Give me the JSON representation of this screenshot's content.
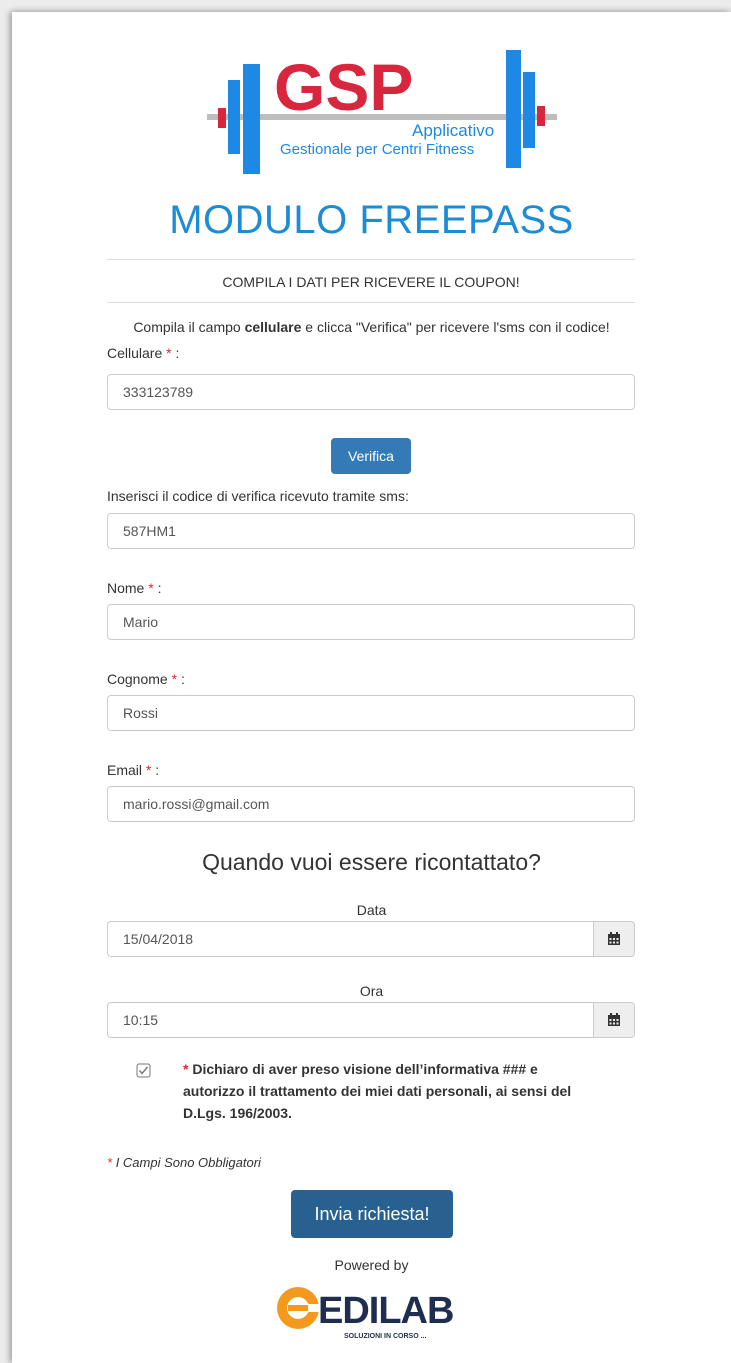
{
  "logo": {
    "text_main": "GSP",
    "text_applicativo": "Applicativo",
    "text_tagline": "Gestionale per Centri Fitness"
  },
  "page_title": "MODULO FREEPASS",
  "subheading": "COMPILA I DATI PER RICEVERE IL COUPON!",
  "instructions": {
    "prefix": "Compila il campo ",
    "bold": "cellulare",
    "suffix": " e clicca \"Verifica\" per ricevere l'sms con il codice!"
  },
  "form": {
    "required_mark": "*",
    "label_colon": ":",
    "cellulare": {
      "label": "Cellulare",
      "value": "333123789"
    },
    "verify_button": "Verifica",
    "codice": {
      "label": "Inserisci il codice di verifica ricevuto tramite sms:",
      "value": "587HM1"
    },
    "nome": {
      "label": "Nome",
      "value": "Mario"
    },
    "cognome": {
      "label": "Cognome",
      "value": "Rossi"
    },
    "email": {
      "label": "Email",
      "value": "mario.rossi@gmail.com"
    },
    "contact_question": "Quando vuoi essere ricontattato?",
    "data": {
      "label": "Data",
      "value": "15/04/2018"
    },
    "ora": {
      "label": "Ora",
      "value": "10:15"
    },
    "declaration": "Dichiaro di aver preso visione dell’informativa ### e autorizzo il trattamento dei miei dati personali, ai sensi del D.Lgs. 196/2003.",
    "declaration_checked": true,
    "mandatory_note": "I Campi Sono Obbligatori",
    "submit_button": "Invia richiesta!"
  },
  "footer": {
    "powered_by": "Powered by",
    "brand_name": "EDILAB",
    "brand_tagline": "SOLUZIONI IN CORSO ..."
  },
  "colors": {
    "title_blue": "#1e8bd5",
    "button_blue": "#337ab7",
    "submit_blue": "#286090",
    "required_red": "#e0262b",
    "logo_red": "#d7263d",
    "logo_blue": "#1e88e5",
    "brand_orange": "#f39a1e",
    "brand_navy": "#1f2d4e"
  },
  "icons": {
    "calendar": "calendar-icon",
    "checkbox": "checkbox-checked-icon"
  }
}
